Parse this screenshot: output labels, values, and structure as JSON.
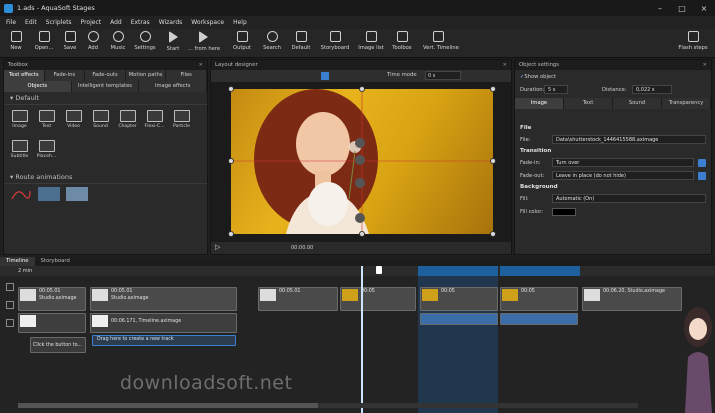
{
  "window": {
    "title": "1.ads - AquaSoft Stages"
  },
  "menu": [
    "File",
    "Edit",
    "Scriplets",
    "Project",
    "Add",
    "Extras",
    "Wizards",
    "Workspace",
    "Help"
  ],
  "toolbar": {
    "items": [
      {
        "label": "New",
        "icon": "new-icon"
      },
      {
        "label": "Open...",
        "icon": "open-icon"
      },
      {
        "label": "Save",
        "icon": "save-icon"
      },
      {
        "label": "Add",
        "icon": "add-icon"
      },
      {
        "label": "Music",
        "icon": "music-icon"
      },
      {
        "label": "Settings",
        "icon": "gear-icon"
      },
      {
        "label": "Start",
        "icon": "play-icon"
      },
      {
        "label": "... from here",
        "icon": "play-from-here-icon"
      },
      {
        "label": "Output",
        "icon": "output-icon"
      },
      {
        "label": "Search",
        "icon": "search-icon"
      },
      {
        "label": "Default",
        "icon": "default-layout-icon"
      },
      {
        "label": "Storyboard",
        "icon": "storyboard-icon"
      },
      {
        "label": "Image list",
        "icon": "image-list-icon"
      },
      {
        "label": "Toolbox",
        "icon": "toolbox-icon"
      },
      {
        "label": "Vert. Timeline",
        "icon": "vertical-timeline-icon"
      },
      {
        "label": "Flash steps",
        "icon": "flash-steps-icon"
      }
    ]
  },
  "toolbox": {
    "title": "Toolbox",
    "tabs_row1": [
      "Text effects",
      "Fade-ins",
      "Fade-outs",
      "Motion paths",
      "Files"
    ],
    "tabs_row2": [
      "Objects",
      "Intelligent templates",
      "Image effects"
    ],
    "section_default": "Default",
    "objects": [
      "Image",
      "Text",
      "Video",
      "Sound",
      "Chapter",
      "Flexi-C...",
      "Particle",
      "Subtitle",
      "Placeh..."
    ],
    "section_route": "Route animations"
  },
  "layout_designer": {
    "title": "Layout designer",
    "time_mode_label": "Time mode",
    "time_mode_value": "0 s",
    "timecode": "00:00.00"
  },
  "object_settings": {
    "title": "Object settings",
    "show_object": "Show object",
    "duration_label": "Duration:",
    "duration_value": "5 s",
    "distance_label": "Distance:",
    "distance_value": "0,022 s",
    "tabs": [
      "Image",
      "Text",
      "Sound",
      "Transparency"
    ],
    "file_section": "File",
    "file_label": "File:",
    "file_value": "Data\\shutterstock_1446415588.aximage",
    "transition_section": "Transition",
    "fade_in_label": "Fade-in:",
    "fade_in_value": "Turn over",
    "fade_out_label": "Fade-out:",
    "fade_out_value": "Leave in place (do not hide)",
    "background_section": "Background",
    "fill_label": "Fill:",
    "fill_value": "Automatic (On)",
    "fill_color_label": "Fill color:"
  },
  "timeline": {
    "tabs": [
      "Timeline",
      "Storyboard"
    ],
    "zoom": "2 min",
    "clip_labels": [
      "00:05.01",
      "Studio.aximage",
      "00:05.01",
      "Studio.aximage",
      "00:06.171, Timeline.aximage",
      "Click the button to...",
      "Drag here to create a new track",
      "00:05.01",
      "00:05",
      "00:05",
      "00:05",
      "00:06.20, Studio.aximage"
    ]
  },
  "watermark": "downloadsoft.net",
  "colors": {
    "accent": "#3b7fd0",
    "playhead": "#cde6ff",
    "selection": "#1e5f9e"
  }
}
